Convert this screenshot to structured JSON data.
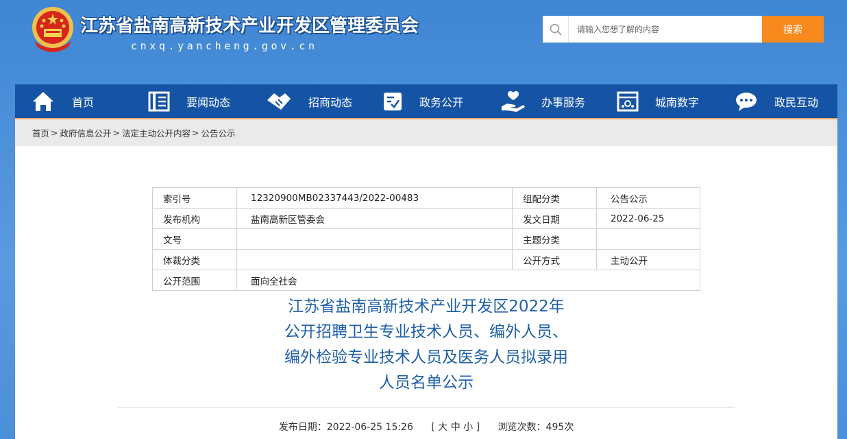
{
  "header": {
    "site_title": "江苏省盐南高新技术产业开发区管理委员会",
    "site_domain": "cnxq.yancheng.gov.cn",
    "emblem_icon": "national-emblem-icon",
    "search": {
      "placeholder": "请输入您想了解的内容",
      "button_label": "搜索",
      "icon": "search-icon"
    }
  },
  "nav": {
    "items": [
      {
        "label": "首页",
        "icon": "home-icon"
      },
      {
        "label": "要闻动态",
        "icon": "news-icon"
      },
      {
        "label": "招商动态",
        "icon": "handshake-icon"
      },
      {
        "label": "政务公开",
        "icon": "document-check-icon"
      },
      {
        "label": "办事服务",
        "icon": "service-hand-icon"
      },
      {
        "label": "城南数字",
        "icon": "digital-screen-icon"
      },
      {
        "label": "政民互动",
        "icon": "chat-icon"
      }
    ]
  },
  "breadcrumb": {
    "items": [
      "首页",
      "政府信息公开",
      "法定主动公开内容",
      "公告公示"
    ],
    "separator": ">"
  },
  "meta_table": {
    "rows": [
      {
        "label1": "索引号",
        "value1": "12320900MB02337443/2022-00483",
        "label2": "组配分类",
        "value2": "公告公示"
      },
      {
        "label1": "发布机构",
        "value1": "盐南高新区管委会",
        "label2": "发文日期",
        "value2": "2022-06-25"
      },
      {
        "label1": "文号",
        "value1": "",
        "label2": "主题分类",
        "value2": ""
      },
      {
        "label1": "体裁分类",
        "value1": "",
        "label2": "公开方式",
        "value2": "主动公开"
      }
    ],
    "last_row": {
      "label": "公开范围",
      "value": "面向全社会"
    }
  },
  "article": {
    "title_lines": [
      "江苏省盐南高新技术产业开发区2022年",
      "公开招聘卫生专业技术人员、编外人员、",
      "编外检验专业技术人员及医务人员拟录用",
      "人员名单公示"
    ],
    "publish_label": "发布日期：",
    "publish_date": "2022-06-25 15:26",
    "font_size_switch": "[ 大 中 小 ]",
    "views_label": "浏览次数：",
    "views_count": "495次"
  },
  "colors": {
    "background": "#4a8fd6",
    "nav": "#1554a5",
    "search_button": "#f7891d",
    "title": "#1e5fa8"
  }
}
